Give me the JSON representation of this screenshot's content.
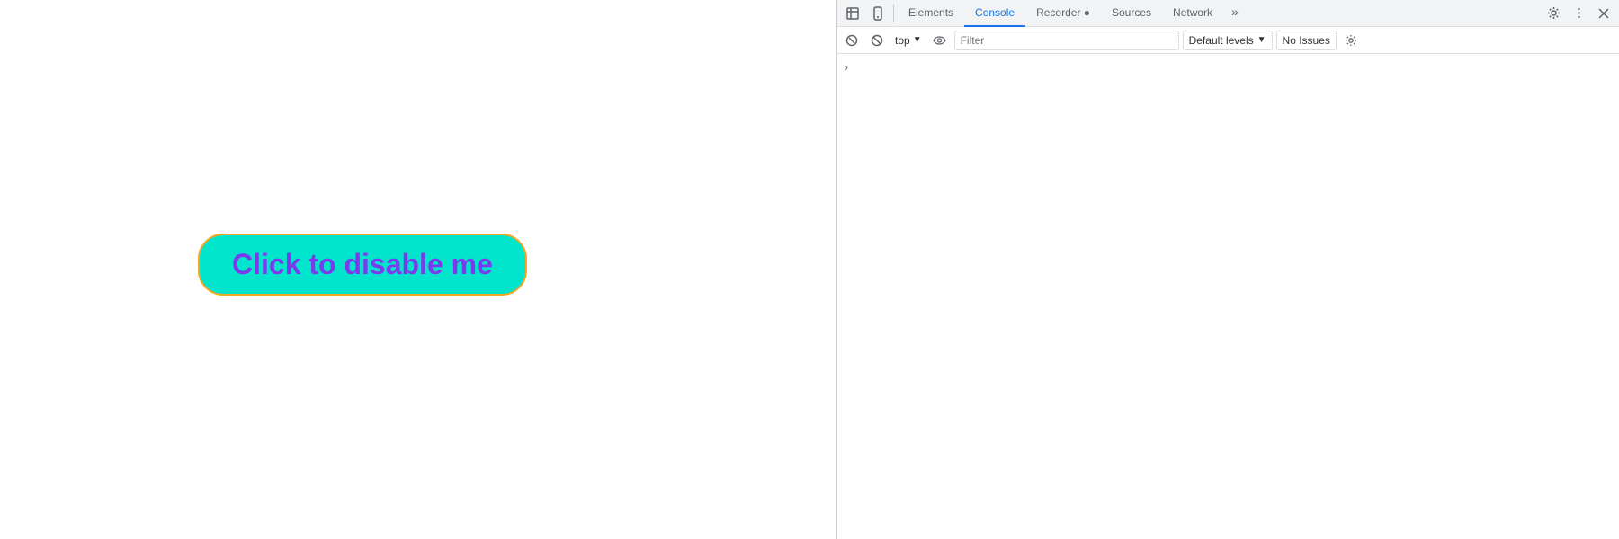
{
  "page": {
    "button_label": "Click to disable me"
  },
  "devtools": {
    "tabs": [
      {
        "id": "elements",
        "label": "Elements",
        "active": false
      },
      {
        "id": "console",
        "label": "Console",
        "active": true
      },
      {
        "id": "recorder",
        "label": "Recorder 🔴",
        "active": false
      },
      {
        "id": "sources",
        "label": "Sources",
        "active": false
      },
      {
        "id": "network",
        "label": "Network",
        "active": false
      }
    ],
    "console_toolbar": {
      "top_label": "top",
      "filter_placeholder": "Filter",
      "levels_label": "Default levels",
      "no_issues_label": "No Issues"
    }
  }
}
